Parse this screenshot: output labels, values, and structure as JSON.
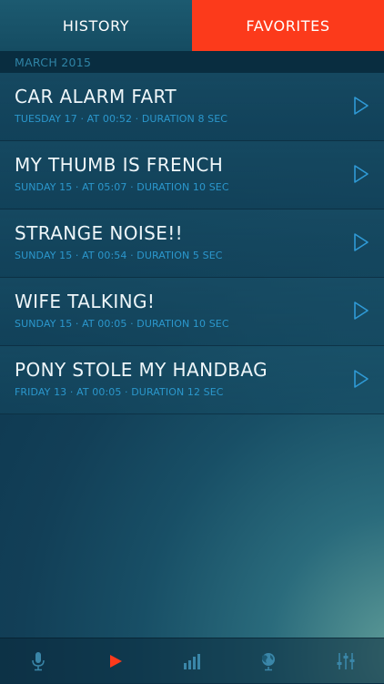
{
  "tabs": {
    "history_label": "HISTORY",
    "favorites_label": "FAVORITES"
  },
  "section": {
    "month": "MARCH 2015"
  },
  "recordings": [
    {
      "title": "CAR ALARM FART",
      "meta": "TUESDAY 17 · AT 00:52 · DURATION 8 SEC"
    },
    {
      "title": "MY THUMB IS FRENCH",
      "meta": "SUNDAY 15 · AT 05:07 · DURATION 10 SEC"
    },
    {
      "title": "STRANGE NOISE!!",
      "meta": "SUNDAY 15 · AT 00:54 · DURATION 5 SEC"
    },
    {
      "title": "WIFE TALKING!",
      "meta": "SUNDAY 15 · AT 00:05 · DURATION 10 SEC"
    },
    {
      "title": "PONY STOLE MY HANDBAG",
      "meta": "FRIDAY 13 · AT 00:05 · DURATION 12 SEC"
    }
  ],
  "bottom_nav": [
    {
      "icon": "microphone-icon",
      "active": false
    },
    {
      "icon": "play-icon",
      "active": true
    },
    {
      "icon": "bar-chart-icon",
      "active": false
    },
    {
      "icon": "globe-icon",
      "active": false
    },
    {
      "icon": "sliders-icon",
      "active": false
    }
  ],
  "colors": {
    "accent": "#fc3a1b",
    "meta_text": "#2b97cc",
    "icon_inactive": "#3a86a8",
    "play_outline": "#2f9ad6"
  }
}
